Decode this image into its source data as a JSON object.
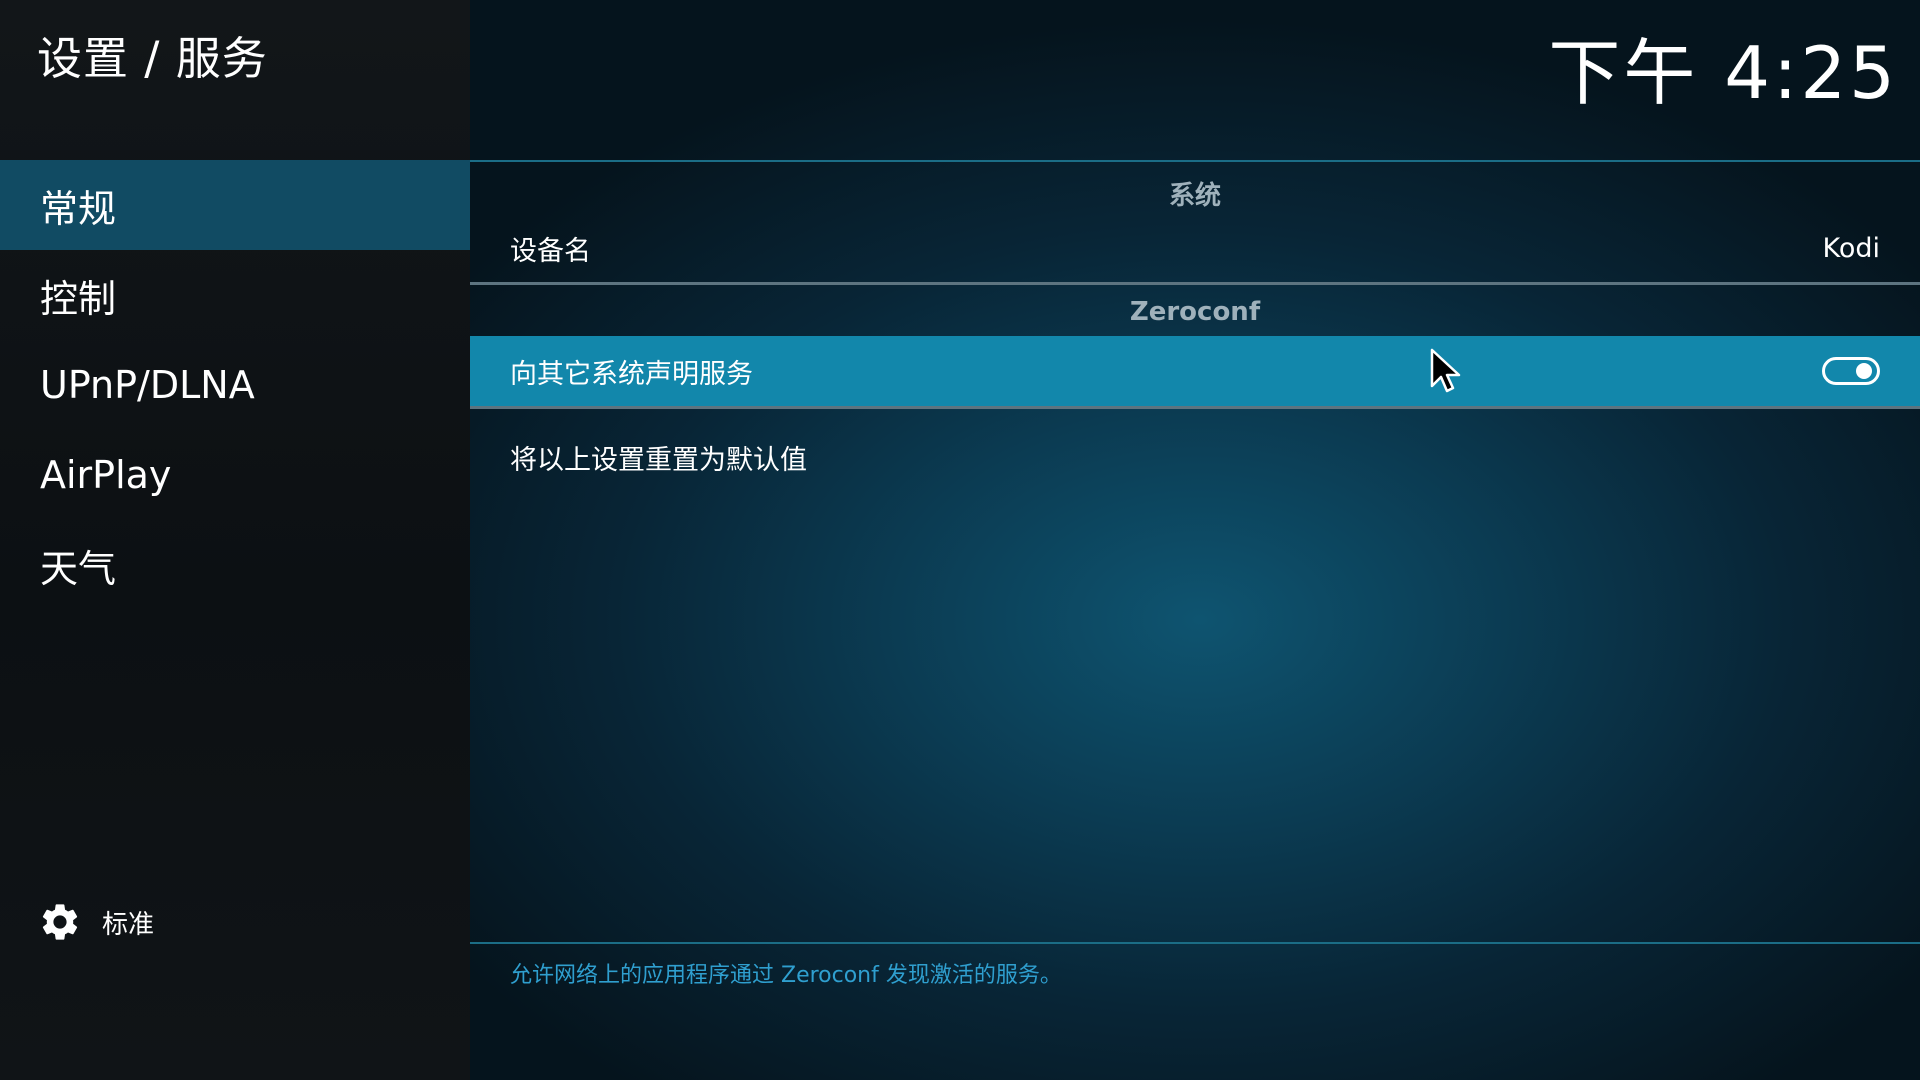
{
  "header": {
    "title": "设置 / 服务",
    "clock": "下午 4:25"
  },
  "sidebar": {
    "items": [
      {
        "label": "常规",
        "active": true
      },
      {
        "label": "控制",
        "active": false
      },
      {
        "label": "UPnP/DLNA",
        "active": false
      },
      {
        "label": "AirPlay",
        "active": false
      },
      {
        "label": "天气",
        "active": false
      }
    ],
    "footer": {
      "icon": "gear-icon",
      "level_label": "标准"
    }
  },
  "main": {
    "groups": [
      {
        "header": "系统",
        "settings": [
          {
            "label": "设备名",
            "value": "Kodi"
          }
        ]
      },
      {
        "header": "Zeroconf",
        "settings": [
          {
            "label": "向其它系统声明服务",
            "value": "on",
            "focused": true
          }
        ]
      }
    ],
    "reset_label": "将以上设置重置为默认值",
    "description": "允许网络上的应用程序通过 Zeroconf 发现激活的服务。"
  },
  "colors": {
    "accent": "#1287ab",
    "active_nav": "#114b63",
    "description_text": "#2f9fcf"
  }
}
